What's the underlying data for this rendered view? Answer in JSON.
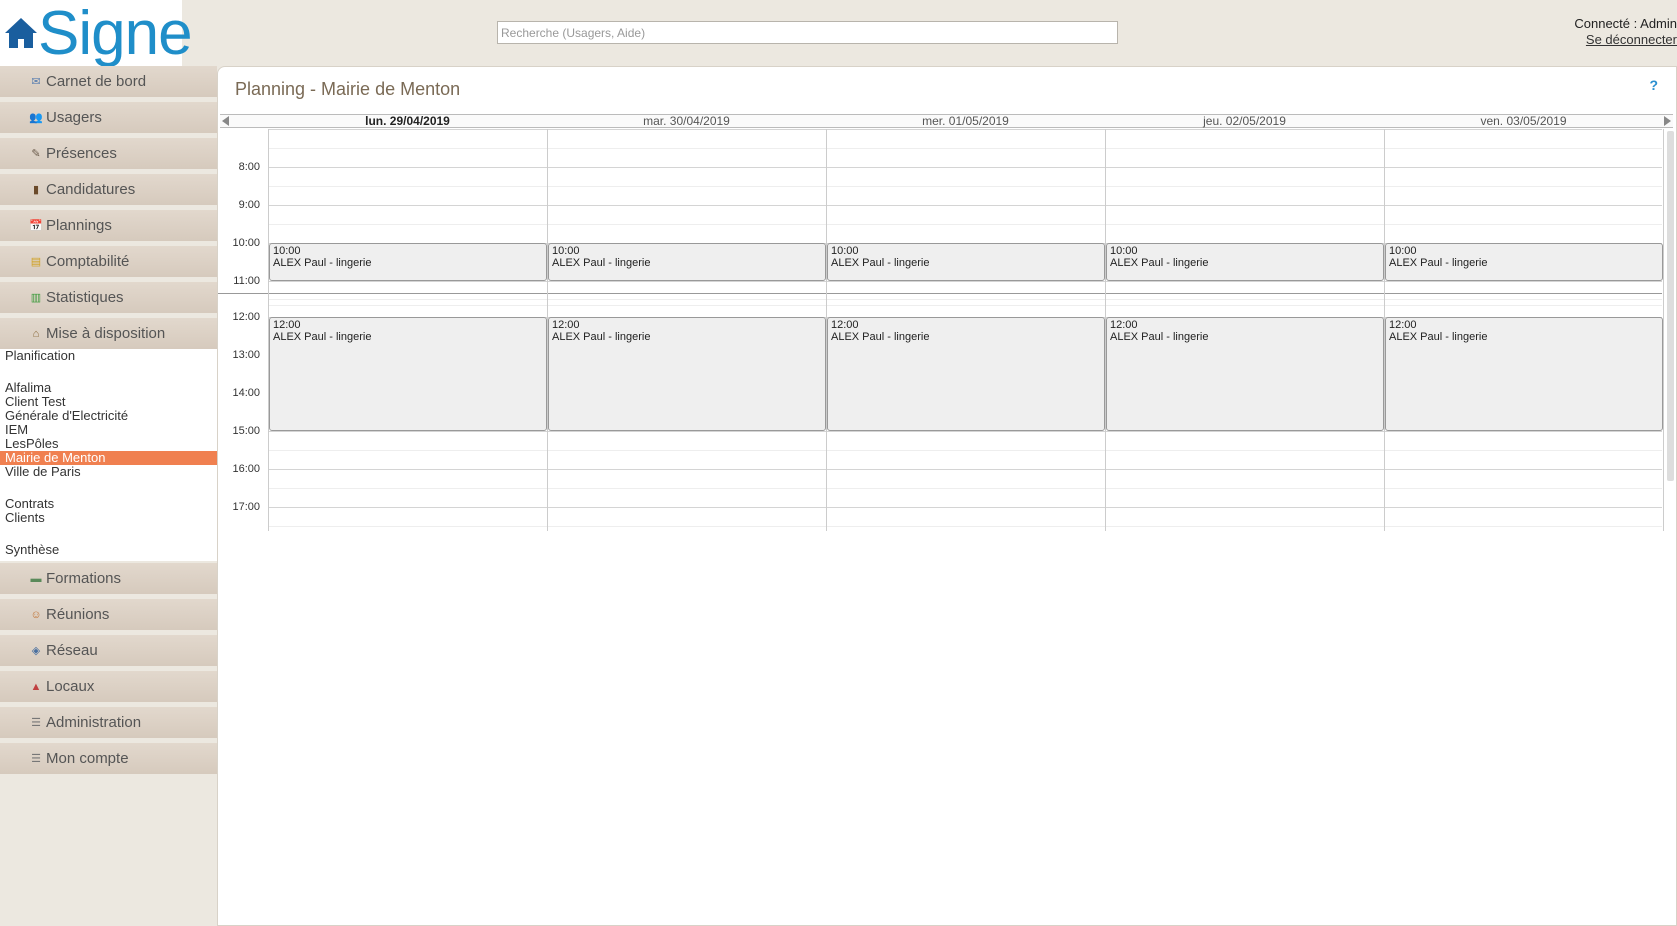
{
  "header": {
    "logo_text": "Signe",
    "search_placeholder": "Recherche (Usagers, Aide)",
    "user_connected": "Connecté : Admin",
    "logout": "Se déconnecter"
  },
  "sidebar": {
    "top_items": [
      {
        "label": "Carnet de bord",
        "icon": "envelope-icon"
      },
      {
        "label": "Usagers",
        "icon": "users-icon"
      },
      {
        "label": "Présences",
        "icon": "pen-icon"
      },
      {
        "label": "Candidatures",
        "icon": "door-icon"
      },
      {
        "label": "Plannings",
        "icon": "calendar-icon"
      },
      {
        "label": "Comptabilité",
        "icon": "coins-icon"
      },
      {
        "label": "Statistiques",
        "icon": "bar-chart-icon"
      },
      {
        "label": "Mise à disposition",
        "icon": "house-user-icon"
      }
    ],
    "submenu": {
      "planification": "Planification",
      "clients": [
        "Alfalima",
        "Client Test",
        "Générale d'Electricité",
        "IEM",
        "LesPôles",
        "Mairie de Menton",
        "Ville de Paris"
      ],
      "active_client": "Mairie de Menton",
      "contrats": "Contrats",
      "clients_link": "Clients",
      "synthese": "Synthèse"
    },
    "bottom_items": [
      {
        "label": "Formations",
        "icon": "board-icon"
      },
      {
        "label": "Réunions",
        "icon": "meeting-icon"
      },
      {
        "label": "Réseau",
        "icon": "network-icon"
      },
      {
        "label": "Locaux",
        "icon": "building-icon"
      },
      {
        "label": "Administration",
        "icon": "settings-list-icon"
      },
      {
        "label": "Mon compte",
        "icon": "settings-list-icon"
      }
    ]
  },
  "main": {
    "title": "Planning - Mairie de Menton",
    "help": "?",
    "days": [
      "lun. 29/04/2019",
      "mar. 30/04/2019",
      "mer. 01/05/2019",
      "jeu. 02/05/2019",
      "ven. 03/05/2019"
    ],
    "times_morning": [
      "8:00",
      "9:00",
      "10:00",
      "11:00"
    ],
    "times_afternoon": [
      "12:00",
      "13:00",
      "14:00",
      "15:00",
      "16:00",
      "17:00"
    ],
    "events": [
      {
        "start": "10:00",
        "end": "11:00",
        "title": "ALEX Paul - lingerie"
      },
      {
        "start": "12:00",
        "end": "15:00",
        "title": "ALEX Paul - lingerie"
      }
    ]
  }
}
